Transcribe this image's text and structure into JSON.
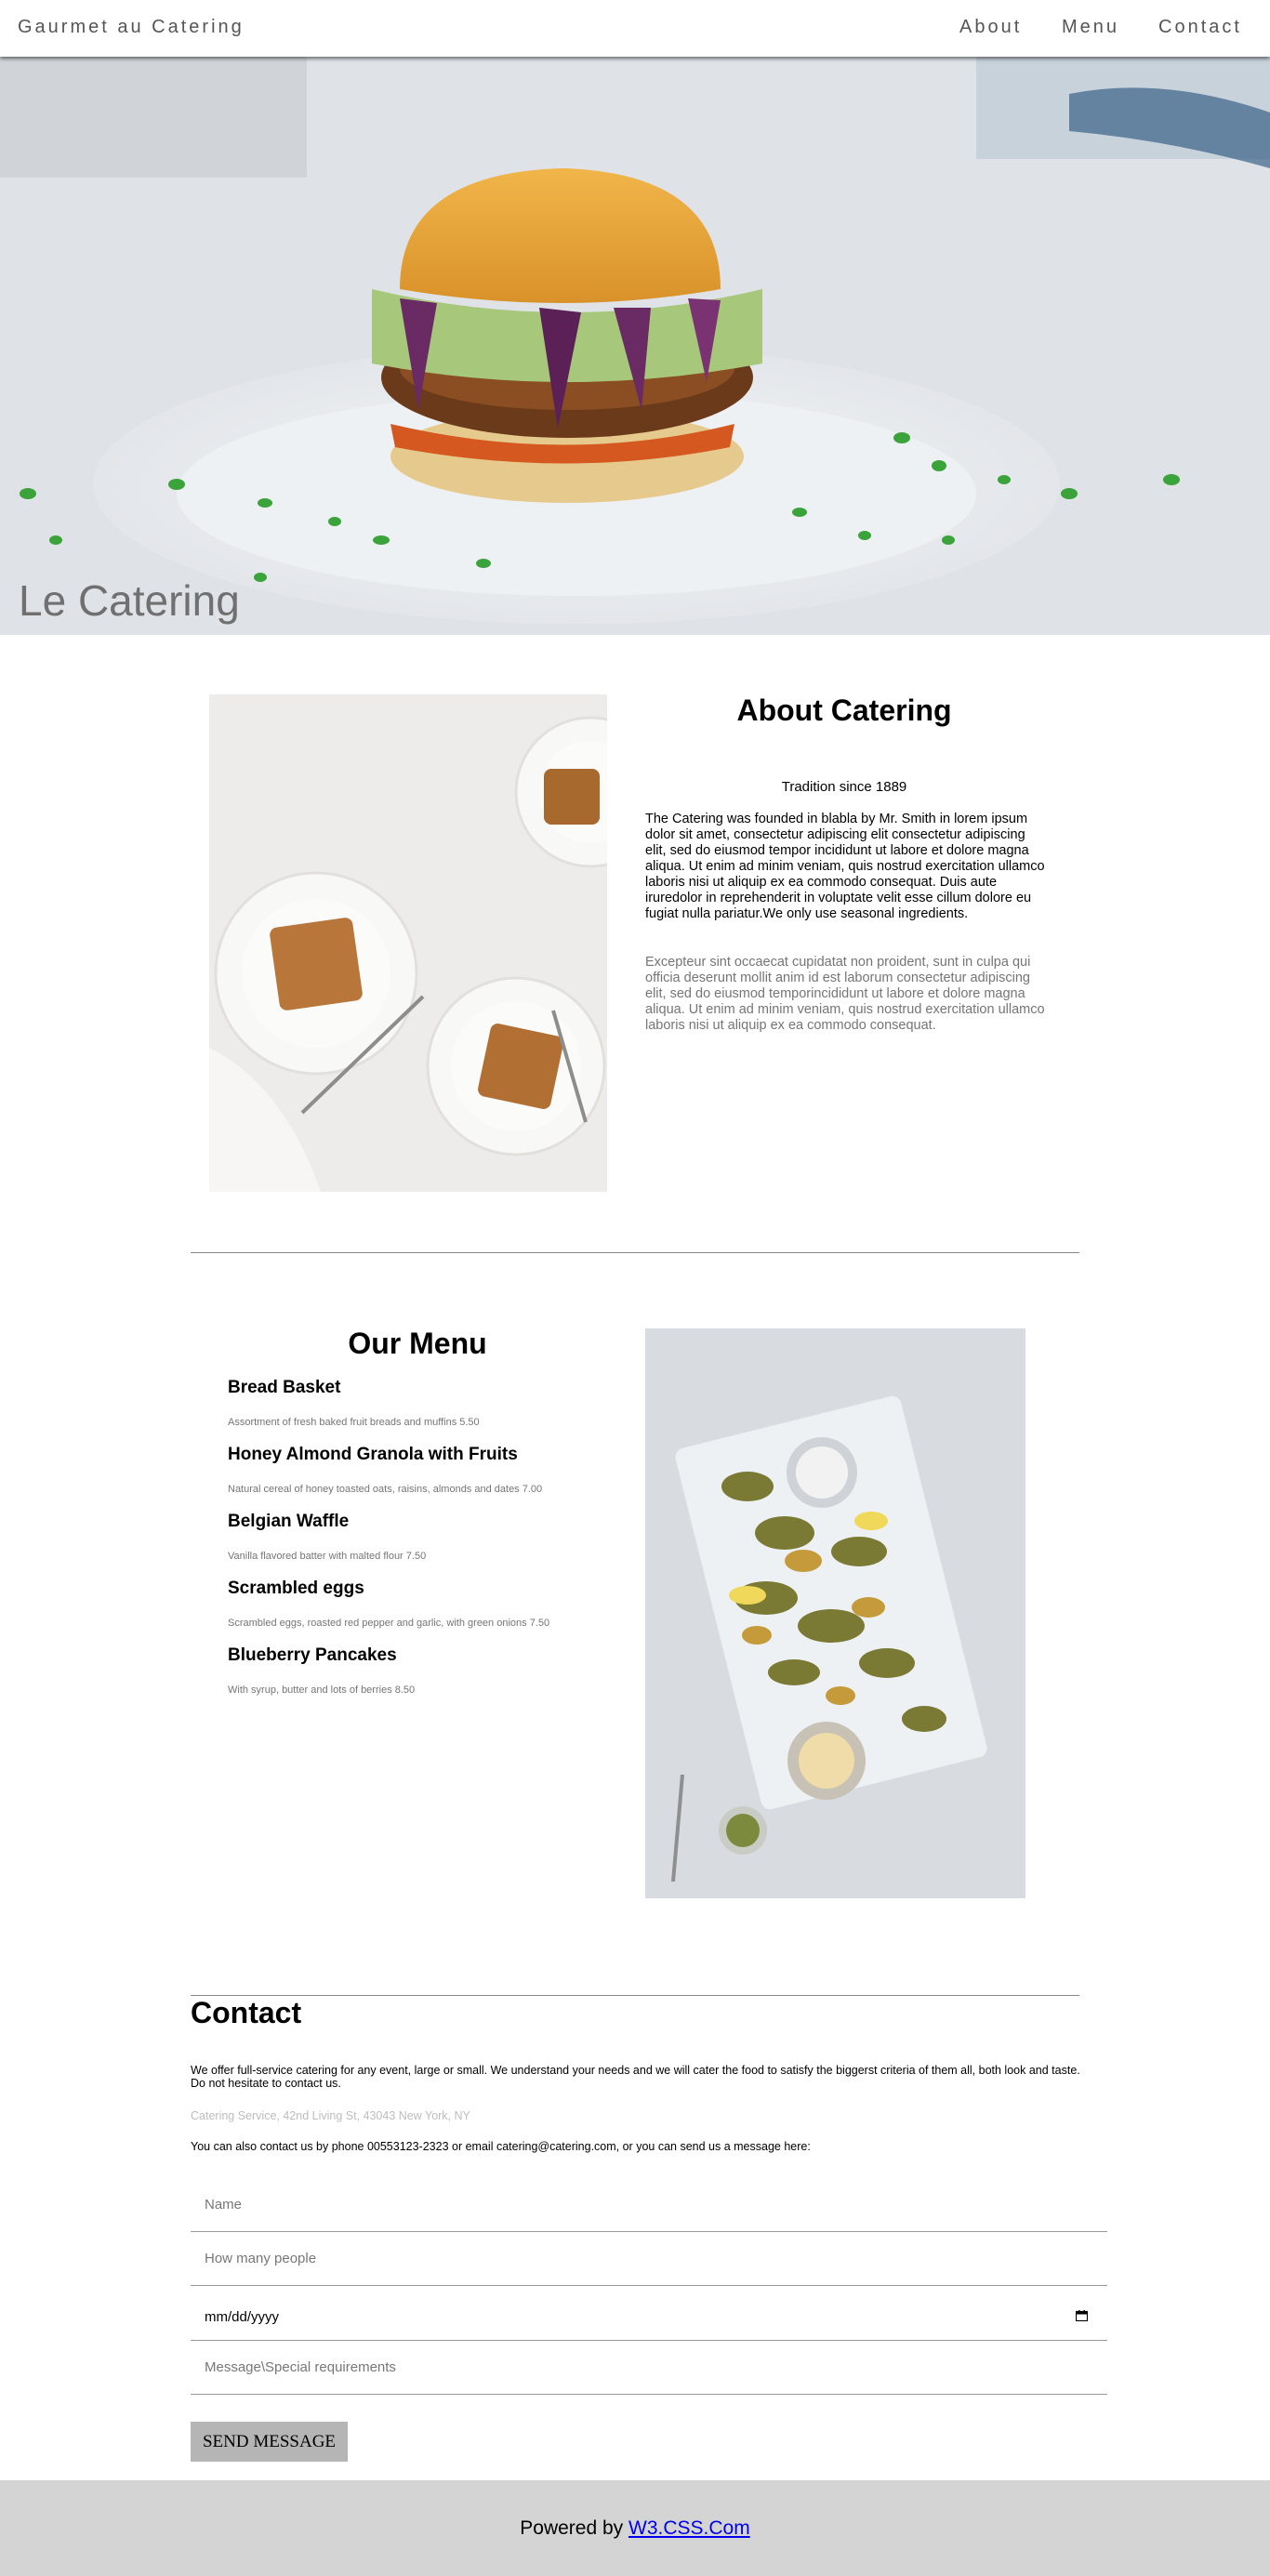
{
  "nav": {
    "brand": "Gaurmet au Catering",
    "links": [
      "About",
      "Menu",
      "Contact"
    ]
  },
  "hero": {
    "title": "Le Catering"
  },
  "about": {
    "heading": "About Catering",
    "tagline": "Tradition since 1889",
    "paragraph1": "The Catering was founded in blabla by Mr. Smith in lorem ipsum dolor sit amet, consectetur adipiscing elit consectetur adipiscing elit, sed do eiusmod tempor incididunt ut labore et dolore magna aliqua. Ut enim ad minim veniam, quis nostrud exercitation ullamco laboris nisi ut aliquip ex ea commodo consequat. Duis aute iruredolor in reprehenderit in voluptate velit esse cillum dolore eu fugiat nulla pariatur.We only use seasonal ingredients.",
    "paragraph2": "Excepteur sint occaecat cupidatat non proident, sunt in culpa qui officia deserunt mollit anim id est laborum consectetur adipiscing elit, sed do eiusmod temporincididunt ut labore et dolore magna aliqua. Ut enim ad minim veniam, quis nostrud exercitation ullamco laboris nisi ut aliquip ex ea commodo consequat."
  },
  "menu": {
    "heading": "Our Menu",
    "items": [
      {
        "name": "Bread Basket",
        "desc": "Assortment of fresh baked fruit breads and muffins 5.50"
      },
      {
        "name": "Honey Almond Granola with Fruits",
        "desc": "Natural cereal of honey toasted oats, raisins, almonds and dates 7.00"
      },
      {
        "name": "Belgian Waffle",
        "desc": "Vanilla flavored batter with malted flour 7.50"
      },
      {
        "name": "Scrambled eggs",
        "desc": "Scrambled eggs, roasted red pepper and garlic, with green onions 7.50"
      },
      {
        "name": "Blueberry Pancakes",
        "desc": "With syrup, butter and lots of berries 8.50"
      }
    ]
  },
  "contact": {
    "heading": "Contact",
    "intro": "We offer full-service catering for any event, large or small. We understand your needs and we will cater the food to satisfy the biggerst criteria of them all, both look and taste. Do not hesitate to contact us.",
    "address": "Catering Service, 42nd Living St, 43043 New York, NY",
    "reach": "You can also contact us by phone 00553123-2323 or email catering@catering.com, or you can send us a message here:",
    "form": {
      "name_placeholder": "Name",
      "people_placeholder": "How many people",
      "date_value": "mm/dd/yyyy",
      "message_placeholder": "Message\\Special requirements",
      "send_label": "SEND MESSAGE"
    }
  },
  "footer": {
    "prefix": "Powered by ",
    "link_text": "W3.CSS.Com"
  }
}
